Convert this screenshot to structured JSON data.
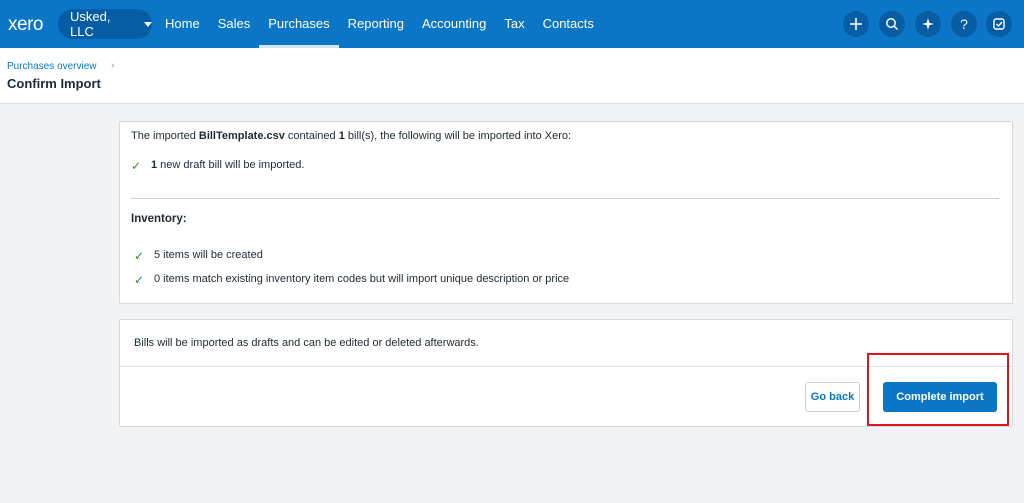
{
  "topbar": {
    "logo": "xero",
    "org_name": "Usked, LLC",
    "nav": [
      "Home",
      "Sales",
      "Purchases",
      "Reporting",
      "Accounting",
      "Tax",
      "Contacts"
    ],
    "active_nav": "Purchases",
    "icons": [
      "plus-icon",
      "search-icon",
      "sparkle-icon",
      "help-icon",
      "notes-icon"
    ]
  },
  "header": {
    "breadcrumb": "Purchases overview",
    "breadcrumb_sep": "›",
    "title": "Confirm Import"
  },
  "summary": {
    "intro_prefix": "The imported ",
    "file_name": "BillTemplate.csv",
    "intro_mid": " contained ",
    "bill_count": "1",
    "intro_suffix": " bill(s), the following will be imported into Xero:",
    "new_count": "1",
    "new_text": " new draft bill will be imported.",
    "inventory_heading": "Inventory:",
    "inventory_line1": "5 items will be created",
    "inventory_line2": "0 items match existing inventory item codes but will import unique description or price"
  },
  "footer": {
    "note": "Bills will be imported as drafts and can be edited or deleted afterwards.",
    "back_label": "Go back",
    "complete_label": "Complete import"
  },
  "colors": {
    "brand": "#0b76c5",
    "check": "#2e8a3a",
    "highlight": "#e0161c"
  }
}
